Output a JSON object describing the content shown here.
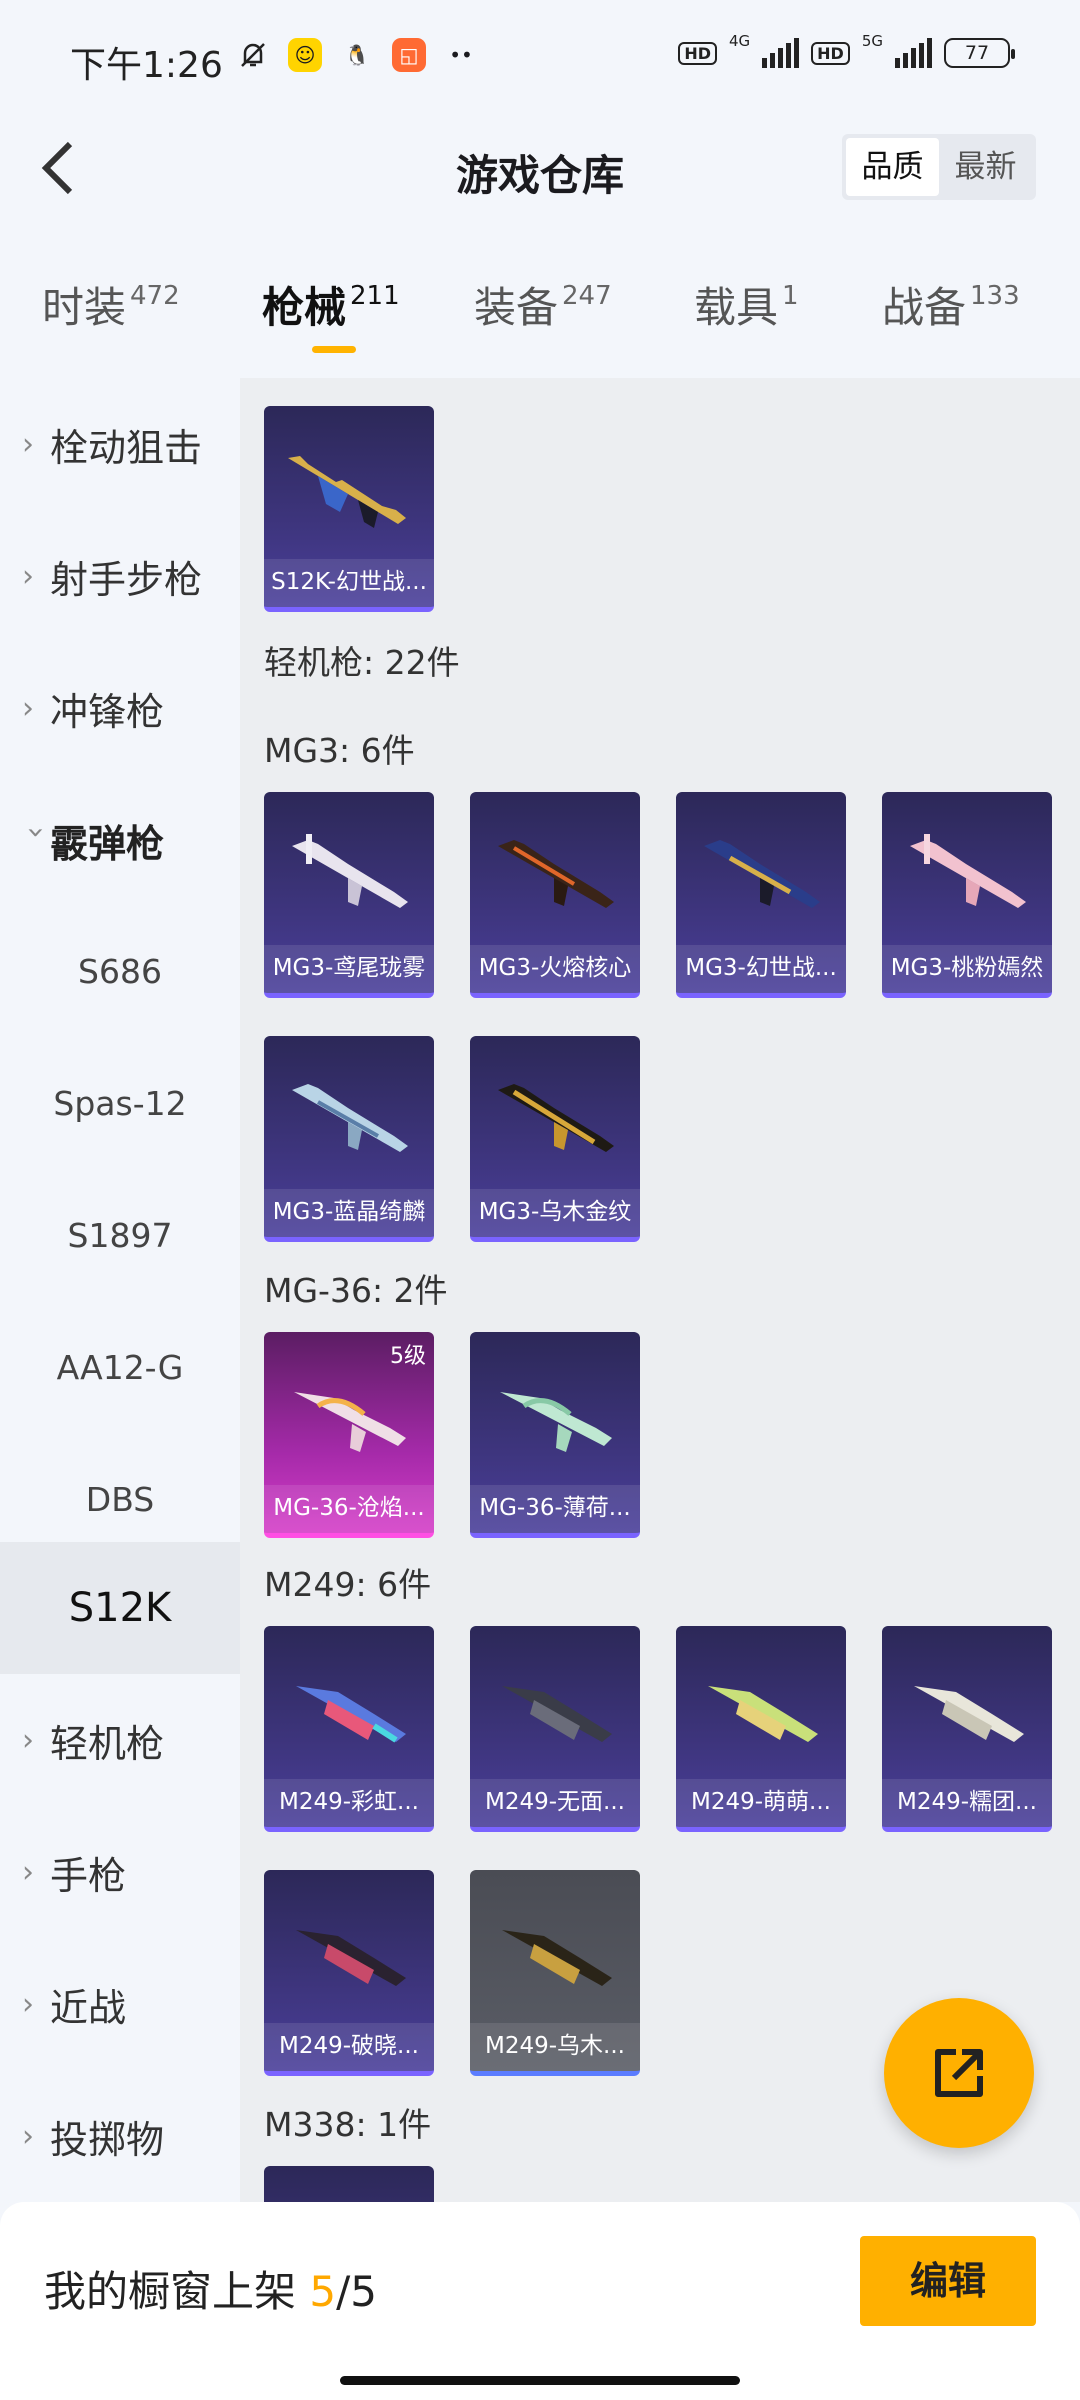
{
  "status": {
    "time": "下午1:26",
    "battery": "77",
    "net1": "4G",
    "net2": "5G",
    "hd": "HD"
  },
  "header": {
    "title": "游戏仓库",
    "sort_quality": "品质",
    "sort_latest": "最新"
  },
  "tabs": [
    {
      "label": "时装",
      "count": "472"
    },
    {
      "label": "枪械",
      "count": "211"
    },
    {
      "label": "装备",
      "count": "247"
    },
    {
      "label": "载具",
      "count": "1"
    },
    {
      "label": "战备",
      "count": "133"
    }
  ],
  "sidebar": {
    "categories": [
      "栓动狙击",
      "射手步枪",
      "冲锋枪",
      "霰弹枪",
      "轻机枪",
      "手枪",
      "近战",
      "投掷物"
    ],
    "subitems": [
      "S686",
      "Spas-12",
      "S1897",
      "AA12-G",
      "DBS",
      "S12K"
    ]
  },
  "main": {
    "top_card": "S12K-幻世战...",
    "lmg_title": "轻机枪: 22件",
    "mg3_title": "MG3: 6件",
    "mg3_cards": [
      "MG3-鸢尾珑雾",
      "MG3-火熔核心",
      "MG3-幻世战...",
      "MG3-桃粉嫣然",
      "MG3-蓝晶绮麟",
      "MG3-乌木金纹"
    ],
    "mg36_title": "MG-36: 2件",
    "mg36_cards": [
      "MG-36-沧焰...",
      "MG-36-薄荷..."
    ],
    "mg36_level": "5级",
    "m249_title": "M249: 6件",
    "m249_cards": [
      "M249-彩虹...",
      "M249-无面...",
      "M249-萌萌...",
      "M249-糯团...",
      "M249-破晓...",
      "M249-乌木..."
    ],
    "m338_title": "M338: 1件"
  },
  "bottom": {
    "shelf_label": "我的橱窗上架",
    "shelf_current": "5",
    "shelf_total": "/5",
    "edit": "编辑"
  },
  "colors": {
    "accent": "#ffb000",
    "card_purple": "#3e357e",
    "card_pink": "#d53dc8"
  }
}
